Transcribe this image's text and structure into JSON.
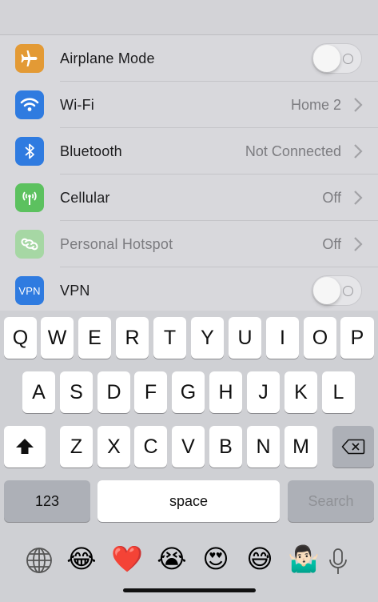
{
  "settings": {
    "rows": [
      {
        "label": "Airplane Mode",
        "value": "",
        "icon": "airplane-icon",
        "color": "#e39a35"
      },
      {
        "label": "Wi-Fi",
        "value": "Home 2",
        "icon": "wifi-icon",
        "color": "#2f7be0"
      },
      {
        "label": "Bluetooth",
        "value": "Not Connected",
        "icon": "bluetooth-icon",
        "color": "#2f7be0"
      },
      {
        "label": "Cellular",
        "value": "Off",
        "icon": "cellular-antenna-icon",
        "color": "#5cc15f"
      },
      {
        "label": "Personal Hotspot",
        "value": "Off",
        "icon": "hotspot-link-icon",
        "color": "#a6d7a4"
      },
      {
        "label": "VPN",
        "value": "",
        "icon": "vpn-icon",
        "color": "#2f7be0",
        "icon_text": "VPN"
      }
    ]
  },
  "keyboard": {
    "row1": [
      "Q",
      "W",
      "E",
      "R",
      "T",
      "Y",
      "U",
      "I",
      "O",
      "P"
    ],
    "row2": [
      "A",
      "S",
      "D",
      "F",
      "G",
      "H",
      "J",
      "K",
      "L"
    ],
    "row3": [
      "Z",
      "X",
      "C",
      "V",
      "B",
      "N",
      "M"
    ],
    "numbers_label": "123",
    "space_label": "space",
    "search_label": "Search"
  },
  "emoji_bar": [
    "😂",
    "❤️",
    "😭",
    "😍",
    "😅",
    "🤷🏻‍♂️"
  ]
}
